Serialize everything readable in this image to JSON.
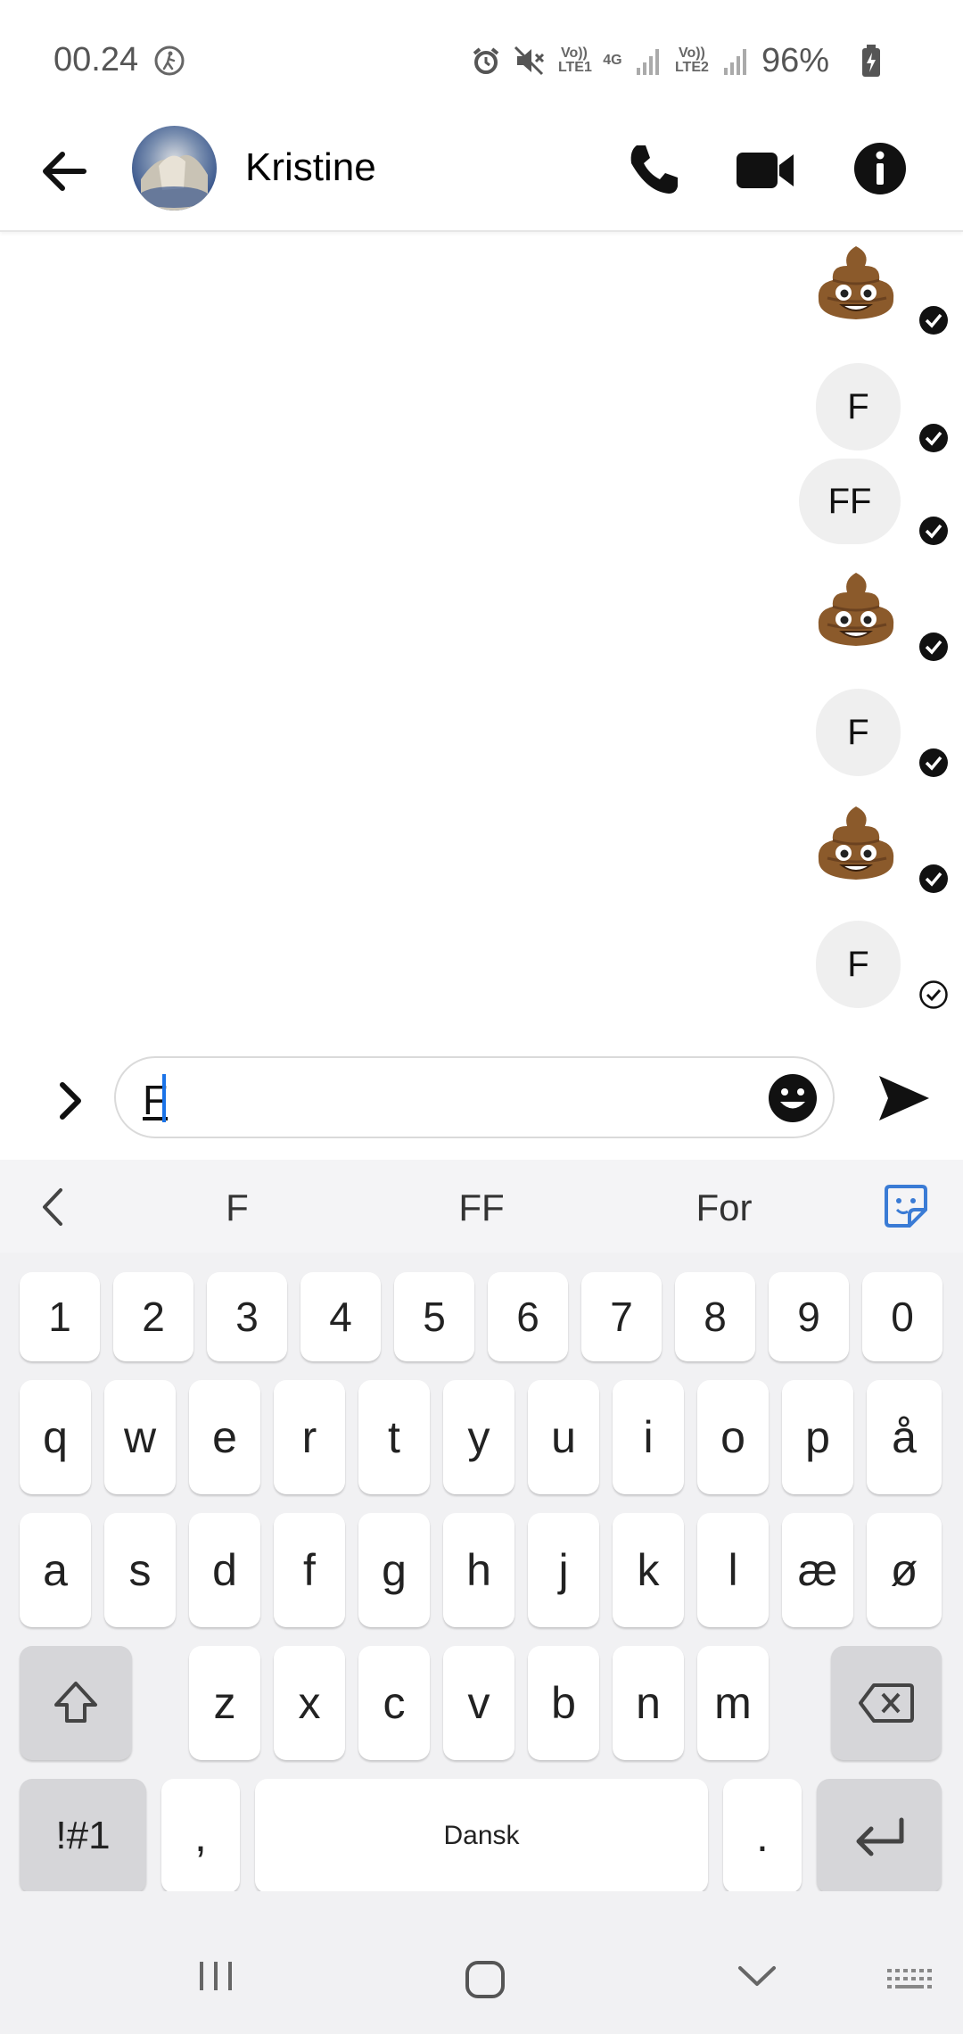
{
  "status_bar": {
    "time": "00.24",
    "lte1": "Vo)) LTE1",
    "net4g": "4G",
    "lte2": "Vo)) LTE2",
    "battery": "96%"
  },
  "header": {
    "contact_name": "Kristine"
  },
  "messages": [
    {
      "type": "emoji",
      "content": "poo-emoji",
      "status": "seen"
    },
    {
      "type": "text",
      "content": "F",
      "status": "seen"
    },
    {
      "type": "text",
      "content": "FF",
      "status": "seen"
    },
    {
      "type": "emoji",
      "content": "poo-emoji",
      "status": "seen"
    },
    {
      "type": "text",
      "content": "F",
      "status": "seen"
    },
    {
      "type": "emoji",
      "content": "poo-emoji",
      "status": "seen"
    },
    {
      "type": "text",
      "content": "F",
      "status": "sent"
    }
  ],
  "composer": {
    "value": "F"
  },
  "keyboard": {
    "suggestions": [
      "F",
      "FF",
      "For"
    ],
    "number_row": [
      "1",
      "2",
      "3",
      "4",
      "5",
      "6",
      "7",
      "8",
      "9",
      "0"
    ],
    "row1": [
      "q",
      "w",
      "e",
      "r",
      "t",
      "y",
      "u",
      "i",
      "o",
      "p",
      "å"
    ],
    "row2": [
      "a",
      "s",
      "d",
      "f",
      "g",
      "h",
      "j",
      "k",
      "l",
      "æ",
      "ø"
    ],
    "row3": [
      "z",
      "x",
      "c",
      "v",
      "b",
      "n",
      "m"
    ],
    "symbols_label": "!#1",
    "comma": ",",
    "space_label": "Dansk",
    "period": "."
  },
  "colors": {
    "accent": "#1a73e8",
    "bubble": "#efefef",
    "keyboard_bg": "#f1f1f3"
  }
}
